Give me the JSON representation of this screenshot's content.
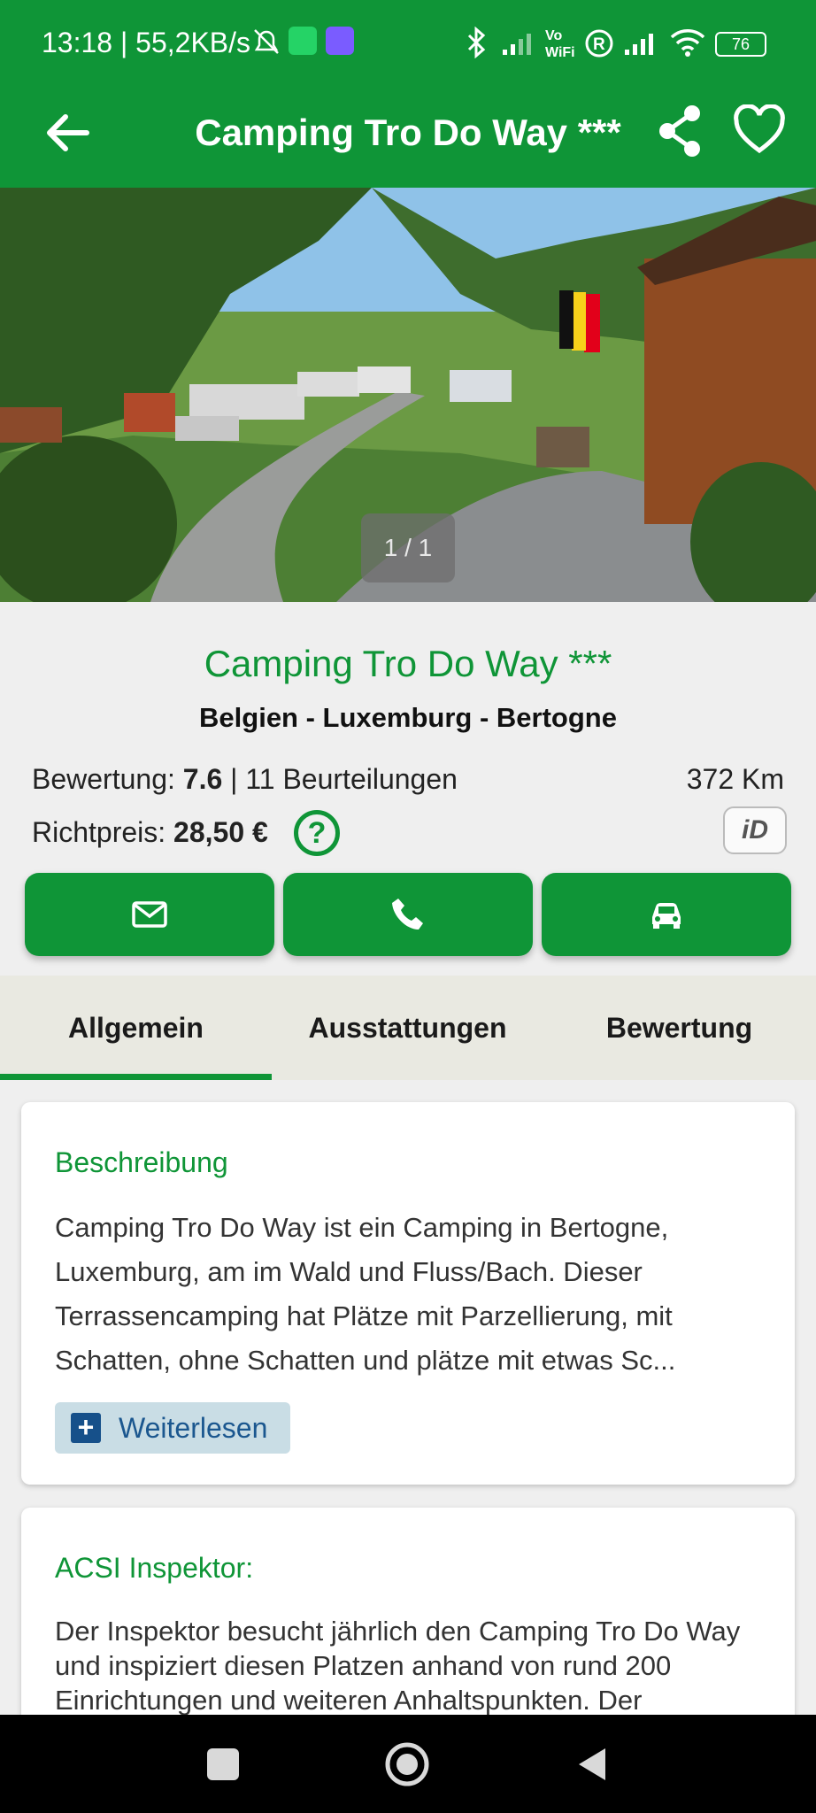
{
  "status_bar": {
    "time": "13:18 | 55,2KB/s",
    "battery": "76"
  },
  "app_bar": {
    "title": "Camping Tro Do Way ***"
  },
  "gallery": {
    "counter": "1 / 1"
  },
  "campsite": {
    "name": "Camping Tro Do Way ***",
    "region": "Belgien  - Luxemburg - Bertogne",
    "rating_label": "Bewertung:",
    "rating_value": "7.6",
    "reviews": "| 11 Beurteilungen",
    "distance": "372 Km",
    "price_label": "Richtpreis:",
    "price_value": "28,50 €",
    "id_badge": "iD"
  },
  "tabs": [
    "Allgemein",
    "Ausstattungen",
    "Bewertung"
  ],
  "description": {
    "heading": "Beschreibung",
    "text": "Camping Tro Do Way ist ein Camping in Bertogne, Luxemburg, am im Wald und Fluss/Bach. Dieser Terrassencamping hat Plätze mit Parzellierung, mit Schatten, ohne Schatten und plätze mit etwas Sc...",
    "read_more": "Weiterlesen"
  },
  "inspector": {
    "heading": "ACSI Inspektor:",
    "text": "Der Inspektor besucht jährlich den Camping Tro Do Way und inspiziert diesen Platzen anhand von rund 200 Einrichtungen und weiteren Anhaltspunkten. Der"
  }
}
